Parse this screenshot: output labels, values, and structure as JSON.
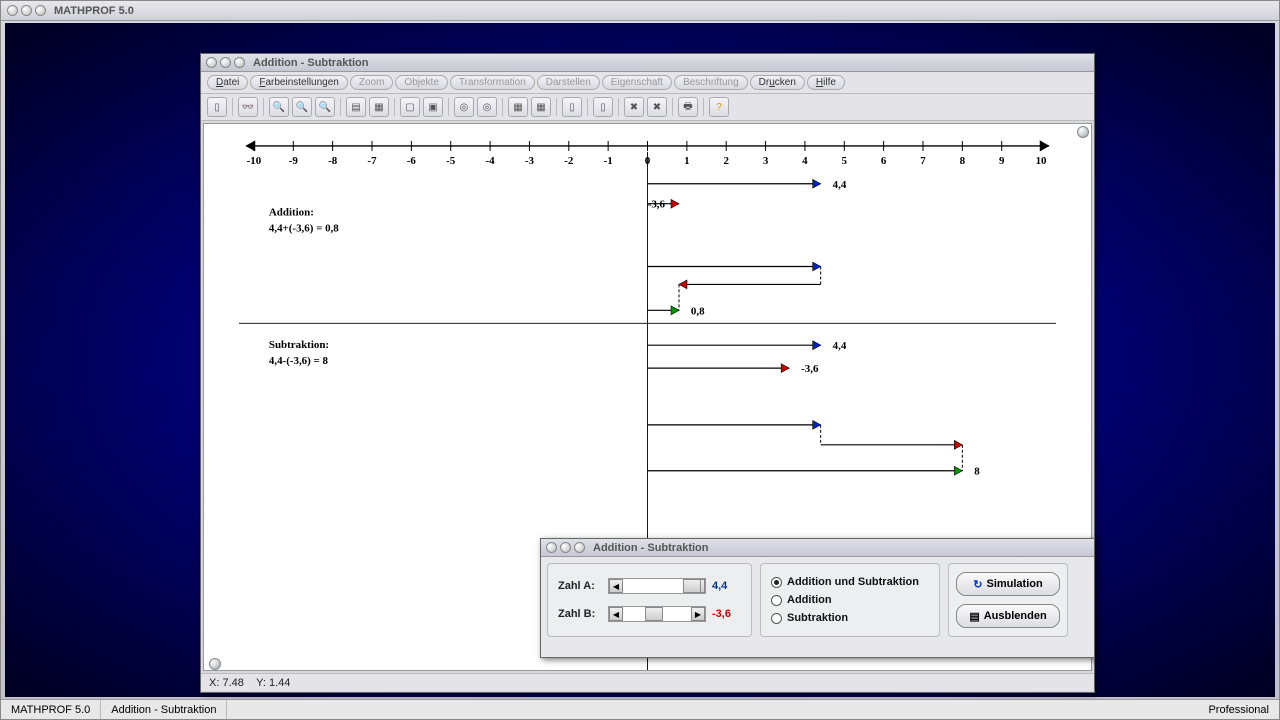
{
  "app": {
    "title": "MATHPROF 5.0"
  },
  "statusbar": {
    "left": "MATHPROF 5.0",
    "mid": "Addition - Subtraktion",
    "right": "Professional"
  },
  "doc": {
    "title": "Addition - Subtraktion",
    "menu": {
      "m1": "Datei",
      "m2": "Farbeinstellungen",
      "m3": "Zoom",
      "m4": "Objekte",
      "m5": "Transformation",
      "m6": "Darstellen",
      "m7": "Eigenschaft",
      "m8": "Beschriftung",
      "m9": "Drucken",
      "m10": "Hilfe"
    },
    "status": {
      "x_label": "X:",
      "x_val": "7.48",
      "y_label": "Y:",
      "y_val": "1.44"
    }
  },
  "chart_data": {
    "type": "other",
    "axis": {
      "min": -10,
      "max": 10,
      "ticks": [
        -10,
        -9,
        -8,
        -7,
        -6,
        -5,
        -4,
        -3,
        -2,
        -1,
        0,
        1,
        2,
        3,
        4,
        5,
        6,
        7,
        8,
        9,
        10
      ]
    },
    "addition": {
      "title": "Addition:",
      "equation": "4,4+(-3,6) = 0,8",
      "a": 4.4,
      "b": -3.6,
      "result": 0.8,
      "label_a": "4,4",
      "label_b": "-3,6",
      "label_r": "0,8"
    },
    "subtraction": {
      "title": "Subtraktion:",
      "equation": "4,4-(-3,6) = 8",
      "a": 4.4,
      "b": -3.6,
      "result": 8,
      "label_a": "4,4",
      "label_b": "-3,6",
      "label_r": "8"
    }
  },
  "ctrl": {
    "title": "Addition - Subtraktion",
    "zahl_a_label": "Zahl A:",
    "zahl_a_value": "4,4",
    "zahl_b_label": "Zahl B:",
    "zahl_b_value": "-3,6",
    "opt1": "Addition und Subtraktion",
    "opt2": "Addition",
    "opt3": "Subtraktion",
    "btn_sim": "Simulation",
    "btn_hide": "Ausblenden"
  }
}
